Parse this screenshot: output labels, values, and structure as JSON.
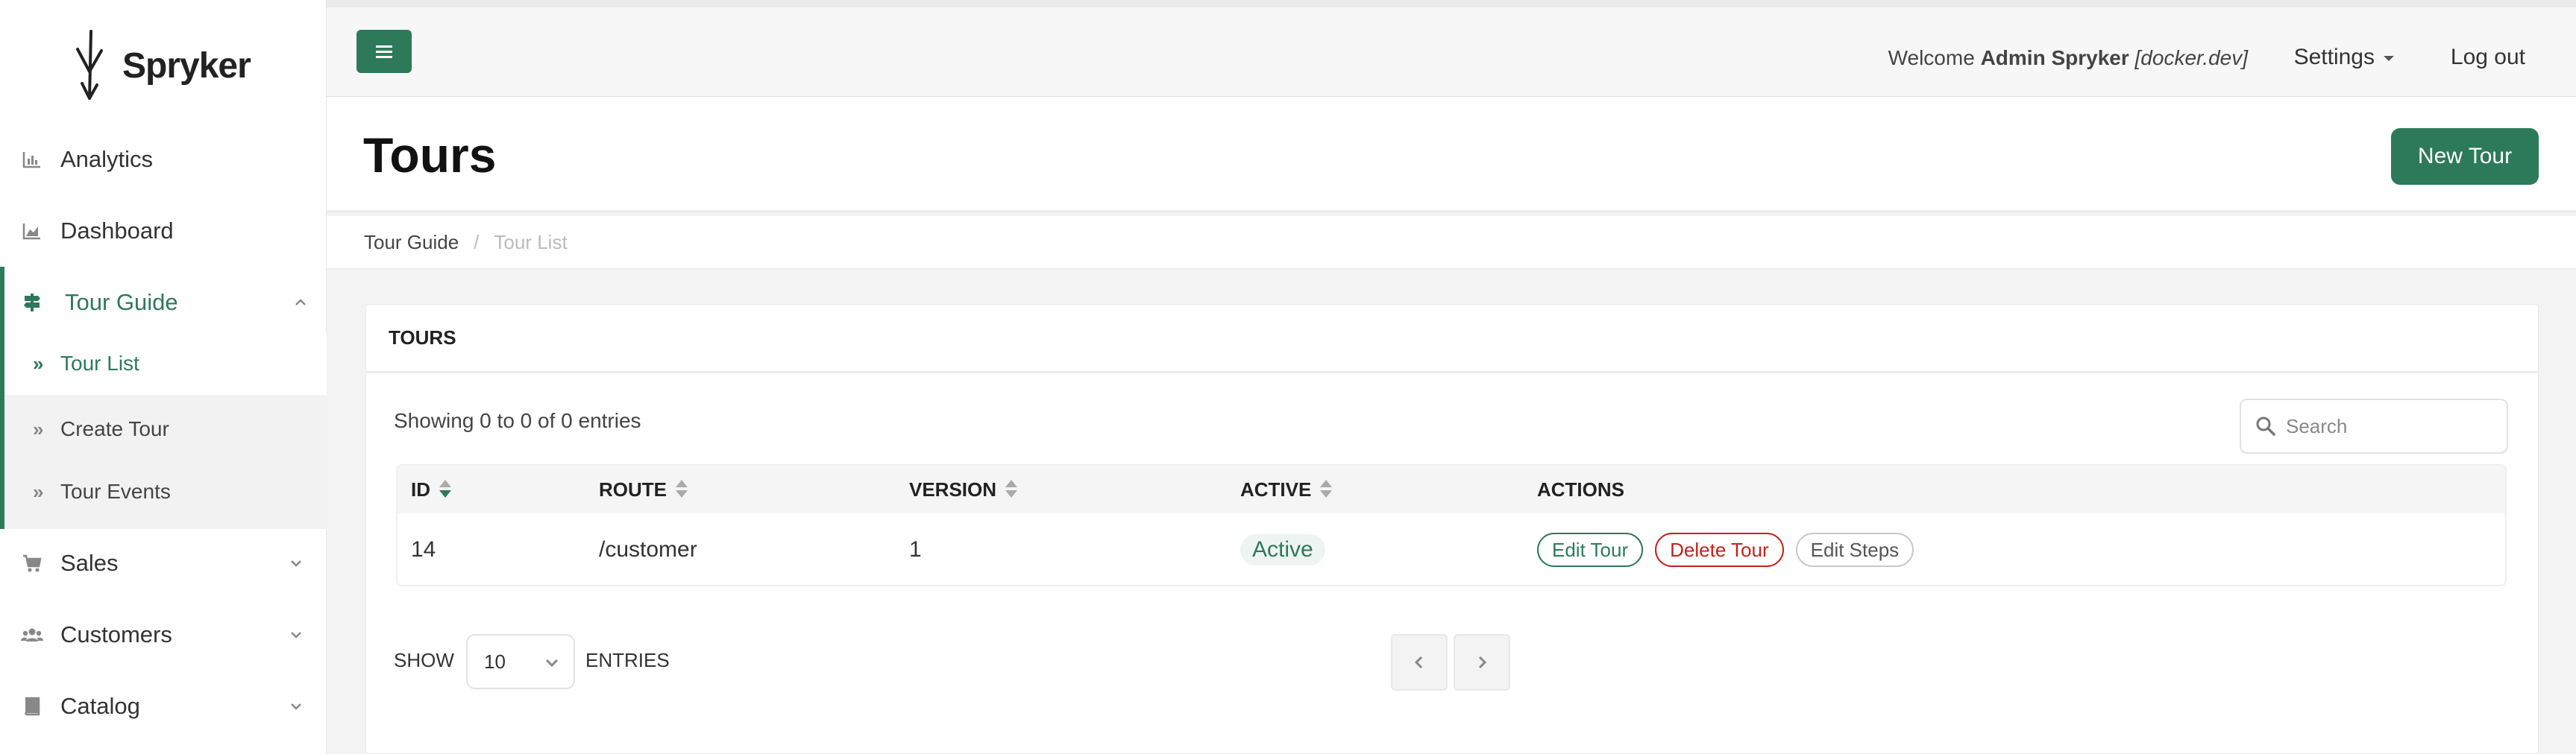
{
  "brand": {
    "name": "Spryker",
    "accent": "#2d7a5b"
  },
  "sidebar": {
    "items": [
      {
        "label": "Analytics",
        "icon": "bar-chart-icon"
      },
      {
        "label": "Dashboard",
        "icon": "area-chart-icon"
      },
      {
        "label": "Tour Guide",
        "icon": "signpost-icon",
        "expanded": true
      },
      {
        "label": "Sales",
        "icon": "cart-icon"
      },
      {
        "label": "Customers",
        "icon": "users-icon"
      },
      {
        "label": "Catalog",
        "icon": "book-icon"
      }
    ],
    "sub_items": [
      {
        "label": "Tour List",
        "current": true
      },
      {
        "label": "Create Tour"
      },
      {
        "label": "Tour Events"
      }
    ]
  },
  "topbar": {
    "welcome_prefix": "Welcome",
    "user_name": "Admin Spryker",
    "environment": "[docker.dev]",
    "settings_label": "Settings",
    "logout_label": "Log out"
  },
  "page": {
    "title": "Tours",
    "new_button": "New Tour"
  },
  "breadcrumb": {
    "parent": "Tour Guide",
    "separator": "/",
    "current": "Tour List"
  },
  "panel": {
    "title": "TOURS",
    "showing": "Showing 0 to 0 of 0 entries",
    "search_placeholder": "Search",
    "columns": [
      "ID",
      "ROUTE",
      "VERSION",
      "ACTIVE",
      "ACTIONS"
    ],
    "rows": [
      {
        "id": "14",
        "route": "/customer",
        "version": "1",
        "active": "Active",
        "actions": [
          "Edit Tour",
          "Delete Tour",
          "Edit Steps"
        ]
      }
    ],
    "show_label": "SHOW",
    "page_size": "10",
    "entries_label": "ENTRIES"
  }
}
